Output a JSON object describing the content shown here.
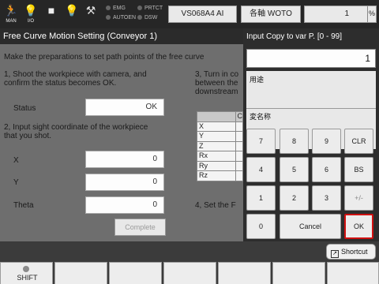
{
  "topbar": {
    "icons": [
      {
        "name": "man-icon",
        "glyph": "🏃",
        "label": "MAN"
      },
      {
        "name": "io-icon",
        "glyph": "💡",
        "label": "I/O"
      },
      {
        "name": "stop-icon",
        "glyph": "■",
        "label": ""
      },
      {
        "name": "lamp-icon",
        "glyph": "💡",
        "label": ""
      },
      {
        "name": "wrench-icon",
        "glyph": "⚒",
        "label": ""
      }
    ],
    "indicators": [
      "EMG",
      "PRTCT",
      "AUTOEN",
      "DSW"
    ],
    "robot_model": "VS068A4 AI",
    "axis_mode": "各軸 WOTO",
    "speed": "1",
    "speed_unit": "%"
  },
  "dialog": {
    "title": "Free Curve Motion Setting (Conveyor 1)",
    "intro": "Make the preparations to set path points of the free curve",
    "step1_line1": "1, Shoot the workpiece with camera, and",
    "step1_line2": "confirm the status becomes OK.",
    "status_label": "Status",
    "status_value": "OK",
    "step2_line1": "2, Input sight coordinate of the workpiece",
    "step2_line2": "that you shot.",
    "x_label": "X",
    "x_value": "0",
    "y_label": "Y",
    "y_value": "0",
    "theta_label": "Theta",
    "theta_value": "0",
    "complete_label": "Complete",
    "step3_line1": "3, Turn in co",
    "step3_line2": "between the",
    "step3_line3": "downstream",
    "table_header": "C",
    "table_rows": [
      "X",
      "Y",
      "Z",
      "Rx",
      "Ry",
      "Rz"
    ],
    "step4": "4, Set the F"
  },
  "keypad": {
    "title": "Input Copy to var P. [0 - 99]",
    "value": "1",
    "info_label1": "用途",
    "info_label2": "変名称",
    "keys": {
      "k7": "7",
      "k8": "8",
      "k9": "9",
      "clr": "CLR",
      "k4": "4",
      "k5": "5",
      "k6": "6",
      "bs": "BS",
      "k1": "1",
      "k2": "2",
      "k3": "3",
      "sign": "+/-",
      "k0": "0",
      "cancel": "Cancel",
      "ok": "OK"
    }
  },
  "bottom": {
    "shortcut_label": "Shortcut",
    "shift_label": "SHIFT"
  },
  "colors": {
    "ok_border": "#d01010",
    "icon_accent": "#f2d24a"
  }
}
